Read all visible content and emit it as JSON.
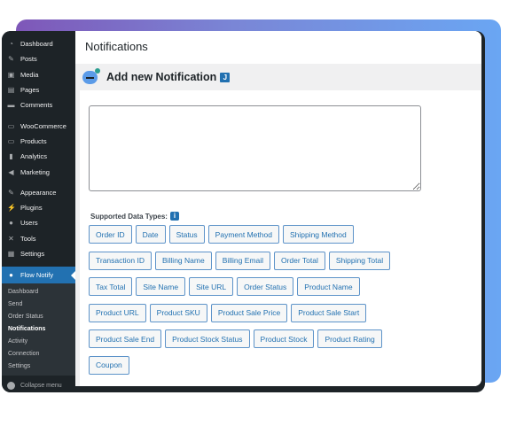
{
  "sidebar": {
    "items": [
      {
        "label": "Dashboard",
        "icon": "dashboard-icon"
      },
      {
        "label": "Posts",
        "icon": "pin-icon"
      },
      {
        "label": "Media",
        "icon": "media-icon"
      },
      {
        "label": "Pages",
        "icon": "pages-icon"
      },
      {
        "label": "Comments",
        "icon": "comment-icon"
      },
      {
        "label": "WooCommerce",
        "icon": "woocommerce-icon"
      },
      {
        "label": "Products",
        "icon": "products-icon"
      },
      {
        "label": "Analytics",
        "icon": "analytics-icon"
      },
      {
        "label": "Marketing",
        "icon": "megaphone-icon"
      },
      {
        "label": "Appearance",
        "icon": "brush-icon"
      },
      {
        "label": "Plugins",
        "icon": "plugin-icon"
      },
      {
        "label": "Users",
        "icon": "user-icon"
      },
      {
        "label": "Tools",
        "icon": "wrench-icon"
      },
      {
        "label": "Settings",
        "icon": "settings-icon"
      }
    ],
    "active": {
      "label": "Flow Notify",
      "icon": "chat-icon"
    },
    "submenu": [
      "Dashboard",
      "Send",
      "Order Status",
      "Notifications",
      "Activity",
      "Connection",
      "Settings"
    ],
    "collapse_label": "Collapse menu"
  },
  "page": {
    "title": "Notifications",
    "section_title": "Add new Notification",
    "badge": "J",
    "message_value": "",
    "supported_label": "Supported Data Types:",
    "info_icon": "i"
  },
  "data_types": [
    [
      "Order ID",
      "Date",
      "Status",
      "Payment Method",
      "Shipping Method"
    ],
    [
      "Transaction ID",
      "Billing Name",
      "Billing Email",
      "Order Total",
      "Shipping Total"
    ],
    [
      "Tax Total",
      "Site Name",
      "Site URL",
      "Order Status",
      "Product Name"
    ],
    [
      "Product URL",
      "Product SKU",
      "Product Sale Price",
      "Product Sale Start"
    ],
    [
      "Product Sale End",
      "Product Stock Status",
      "Product Stock",
      "Product Rating"
    ],
    [
      "Coupon"
    ]
  ],
  "colors": {
    "accent": "#2271b1",
    "sidebar": "#1d2327"
  }
}
